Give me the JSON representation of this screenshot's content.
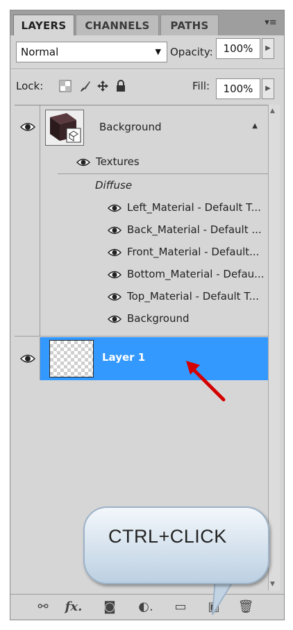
{
  "tabs": [
    {
      "label": "LAYERS",
      "active": true
    },
    {
      "label": "CHANNELS",
      "active": false
    },
    {
      "label": "PATHS",
      "active": false
    }
  ],
  "panel_menu_icon": "panel-menu-icon",
  "blend_mode": {
    "value": "Normal"
  },
  "opacity": {
    "label": "Opacity:",
    "value": "100%"
  },
  "lock": {
    "label": "Lock:",
    "icons": [
      "lock-transparent-pixels-icon",
      "lock-image-pixels-icon",
      "lock-position-icon",
      "lock-all-icon"
    ]
  },
  "fill": {
    "label": "Fill:",
    "value": "100%"
  },
  "layers": {
    "background": {
      "name": "Background",
      "visible": true
    },
    "textures": {
      "label": "Textures"
    },
    "diffuse": {
      "label": "Diffuse"
    },
    "materials": [
      "Left_Material - Default T...",
      "Back_Material - Default ...",
      "Front_Material - Default...",
      "Bottom_Material - Defau...",
      "Top_Material - Default T...",
      "Background"
    ],
    "layer1": {
      "name": "Layer 1",
      "selected": true,
      "visible": true
    }
  },
  "toolbar_icons": [
    "link-layers-icon",
    "fx-icon",
    "layer-mask-icon",
    "adjustment-layer-icon",
    "new-group-icon",
    "new-layer-icon",
    "trash-icon"
  ],
  "callout": {
    "text": "CTRL+CLICK"
  },
  "colors": {
    "selection": "#3399ff",
    "panel": "#d6d6d6",
    "arrow": "#d40000"
  }
}
